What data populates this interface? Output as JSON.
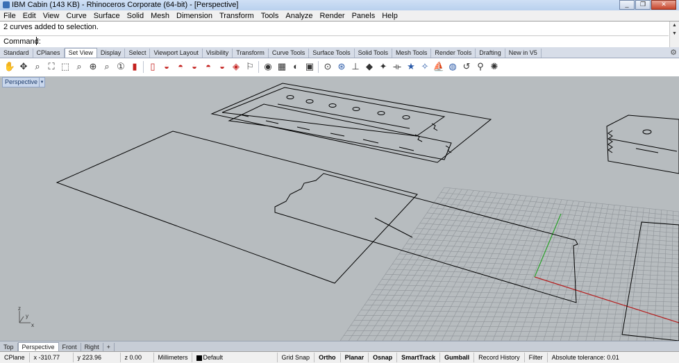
{
  "window": {
    "title": "IBM Cabin (143 KB) - Rhinoceros Corporate (64-bit) - [Perspective]",
    "controls": [
      "_",
      "❐",
      "✕"
    ]
  },
  "menu": [
    "File",
    "Edit",
    "View",
    "Curve",
    "Surface",
    "Solid",
    "Mesh",
    "Dimension",
    "Transform",
    "Tools",
    "Analyze",
    "Render",
    "Panels",
    "Help"
  ],
  "command": {
    "history": "2 curves added to selection.",
    "prompt": "Command:",
    "value": ""
  },
  "toolbar_tabs": [
    {
      "label": "Standard",
      "active": false
    },
    {
      "label": "CPlanes",
      "active": false
    },
    {
      "label": "Set View",
      "active": true
    },
    {
      "label": "Display",
      "active": false
    },
    {
      "label": "Select",
      "active": false
    },
    {
      "label": "Viewport Layout",
      "active": false
    },
    {
      "label": "Visibility",
      "active": false
    },
    {
      "label": "Transform",
      "active": false
    },
    {
      "label": "Curve Tools",
      "active": false
    },
    {
      "label": "Surface Tools",
      "active": false
    },
    {
      "label": "Solid Tools",
      "active": false
    },
    {
      "label": "Mesh Tools",
      "active": false
    },
    {
      "label": "Render Tools",
      "active": false
    },
    {
      "label": "Drafting",
      "active": false
    },
    {
      "label": "New in V5",
      "active": false
    }
  ],
  "toolbar_icons": [
    "pan-hand",
    "rotate-view",
    "zoom",
    "zoom-extents",
    "zoom-window",
    "zoom-selected",
    "zoom-target",
    "zoom-lens",
    "zoom-1to1",
    "named-views",
    "capsule-view",
    "car-front",
    "car-side",
    "car-rear",
    "car-top",
    "car-bottom",
    "car-perspective",
    "camera-set",
    "camera",
    "background-bitmap",
    "view-to-plane",
    "pop-view",
    "target",
    "target-cplane",
    "clipping-plane",
    "box-view",
    "walkabout",
    "plane-view",
    "star",
    "star-light",
    "boat",
    "disk",
    "undo-view",
    "walk",
    "sun"
  ],
  "viewport": {
    "label": "Perspective",
    "dropdown": "▾",
    "axis": {
      "x": "x",
      "y": "y",
      "z": "z"
    }
  },
  "viewport_tabs": [
    {
      "label": "Top",
      "active": false
    },
    {
      "label": "Perspective",
      "active": true
    },
    {
      "label": "Front",
      "active": false
    },
    {
      "label": "Right",
      "active": false
    },
    {
      "label": "+",
      "active": false
    }
  ],
  "status": {
    "cplane": "CPlane",
    "x": "x -310.77",
    "y": "y 223.96",
    "z": "z 0.00",
    "units": "Millimeters",
    "layer": "Default",
    "toggles": [
      {
        "label": "Grid Snap",
        "bold": false
      },
      {
        "label": "Ortho",
        "bold": true
      },
      {
        "label": "Planar",
        "bold": true
      },
      {
        "label": "Osnap",
        "bold": true
      },
      {
        "label": "SmartTrack",
        "bold": true
      },
      {
        "label": "Gumball",
        "bold": true
      },
      {
        "label": "Record History",
        "bold": false
      },
      {
        "label": "Filter",
        "bold": false
      }
    ],
    "tolerance": "Absolute tolerance: 0.01"
  },
  "colors": {
    "viewport_bg": "#b7bcbf",
    "grid": "#8f9499",
    "x_axis": "#b41e1e",
    "y_axis": "#2aa02a",
    "curves": "#000000"
  }
}
